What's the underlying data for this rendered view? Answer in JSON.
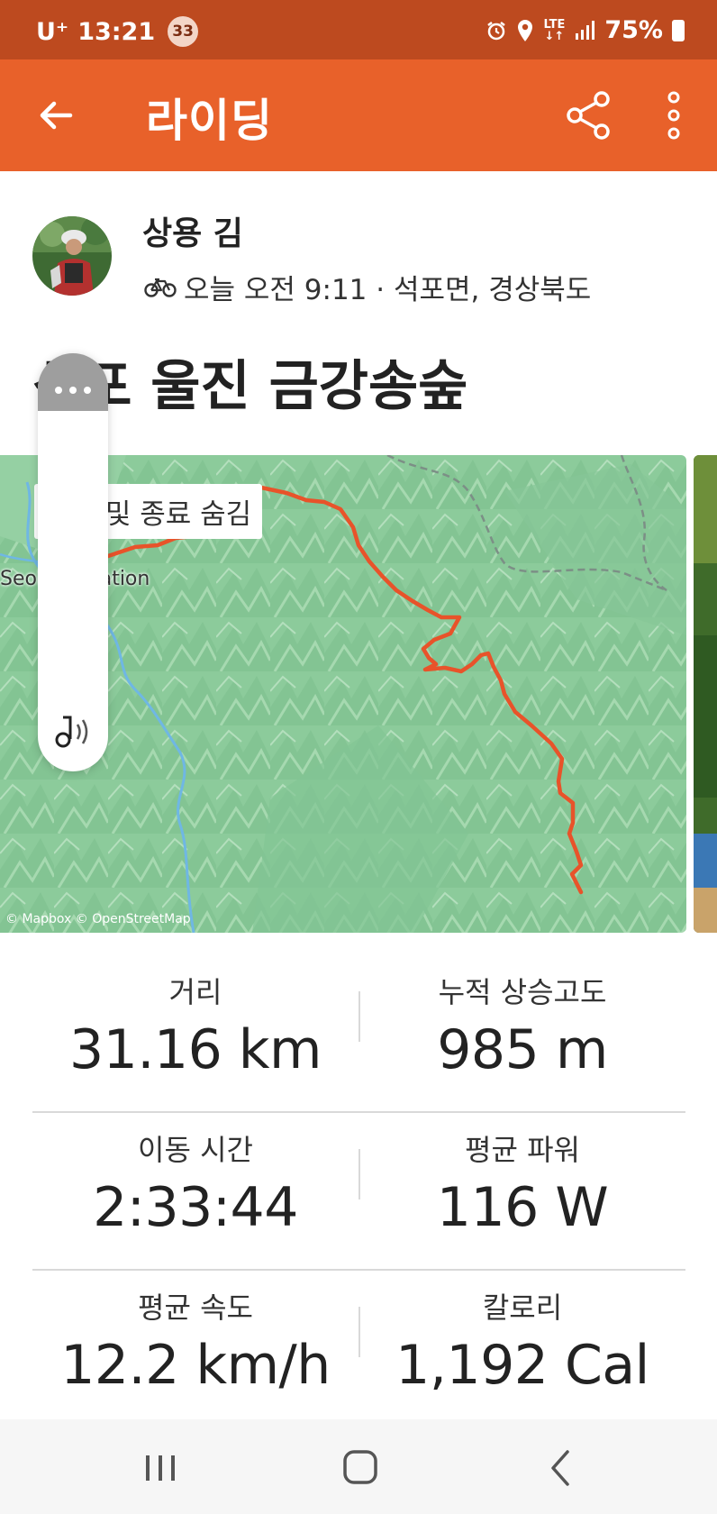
{
  "status_bar": {
    "carrier": "U⁺",
    "time": "13:21",
    "notification_count": "33",
    "network": "LTE",
    "battery": "75%"
  },
  "app_bar": {
    "title": "라이딩",
    "back_icon": "arrow-left-icon",
    "share_icon": "share-icon",
    "more_icon": "more-vertical-icon"
  },
  "athlete": {
    "name": "상용 김",
    "activity_icon": "bicycle-icon",
    "meta": "오늘 오전 9:11 · 석포면, 경상북도"
  },
  "activity": {
    "title": "석포 울진 금강송숲"
  },
  "map": {
    "privacy_chip": "시작 및 종료 숨김",
    "place_label": "Seokpo Station",
    "attribution": "© Mapbox © OpenStreetMap",
    "route_color": "#e8532a"
  },
  "side_panel": {
    "menu_icon": "more-horizontal-icon",
    "audio_icon": "music-sound-icon"
  },
  "stats": [
    {
      "left": {
        "label": "거리",
        "value": "31.16 km"
      },
      "right": {
        "label": "누적 상승고도",
        "value": "985 m"
      }
    },
    {
      "left": {
        "label": "이동 시간",
        "value": "2:33:44"
      },
      "right": {
        "label": "평균 파워",
        "value": "116 W"
      }
    },
    {
      "left": {
        "label": "평균 속도",
        "value": "12.2 km/h"
      },
      "right": {
        "label": "칼로리",
        "value": "1,192 Cal"
      }
    }
  ],
  "nav_bar": {
    "recents_icon": "recents-icon",
    "home_icon": "home-icon",
    "back_icon": "back-chevron-icon"
  },
  "colors": {
    "brand": "#e8612a",
    "status_bar": "#bd4a1f",
    "map_base": "#8fcf9f"
  }
}
